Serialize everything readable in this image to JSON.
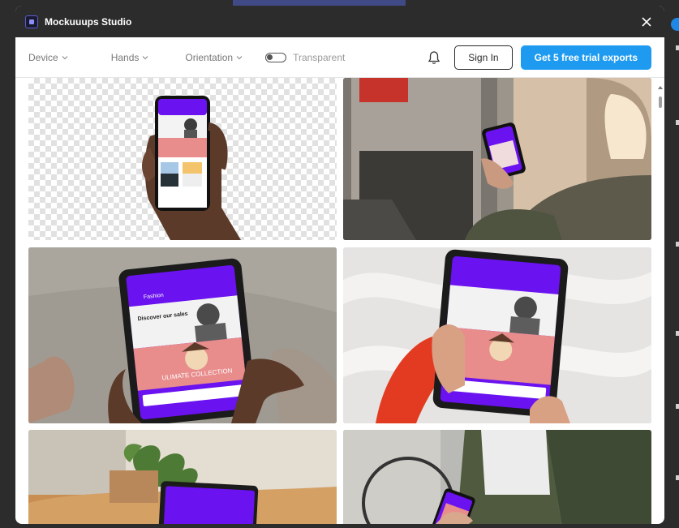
{
  "app": {
    "title": "Mockuuups Studio"
  },
  "toolbar": {
    "device_label": "Device",
    "hands_label": "Hands",
    "orientation_label": "Orientation",
    "transparent_label": "Transparent",
    "transparent_on": false,
    "signin_label": "Sign In",
    "trial_label": "Get 5 free trial exports"
  },
  "mockup_screen": {
    "brand": "Fashion",
    "headline": "Discover our sales",
    "banner": "ULIMATE COLLECTION"
  },
  "colors": {
    "titlebar": "#2c2c2c",
    "accent": "#1e9bf0",
    "screen_purple": "#6a12f0",
    "banner_pink": "#e88c8c"
  },
  "gallery": [
    {
      "name": "hand-phone-transparent"
    },
    {
      "name": "airplane-seat-phone"
    },
    {
      "name": "tablet-grey-wall"
    },
    {
      "name": "tablet-water-background"
    },
    {
      "name": "tablet-on-table"
    },
    {
      "name": "phone-bike-man"
    }
  ]
}
